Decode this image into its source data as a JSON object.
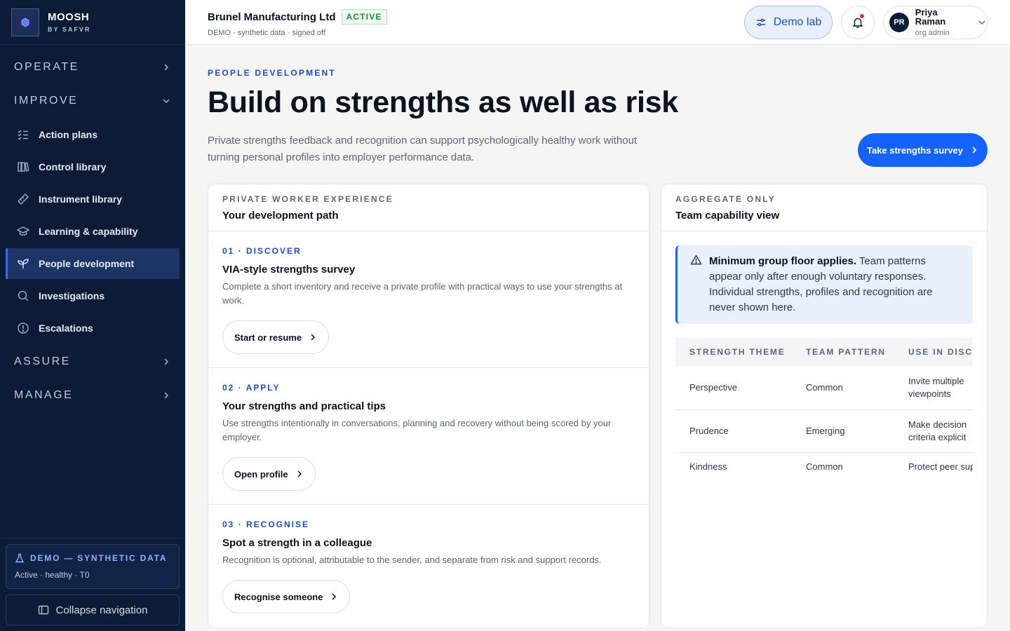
{
  "brand": {
    "name": "MOOSH",
    "sub": "BY SAFVR"
  },
  "sidebar": {
    "sections": [
      {
        "label": "OPERATE",
        "expanded": false
      },
      {
        "label": "IMPROVE",
        "expanded": true
      },
      {
        "label": "ASSURE",
        "expanded": false
      },
      {
        "label": "MANAGE",
        "expanded": false
      }
    ],
    "items": [
      {
        "label": "Action plans",
        "icon": "checklist-icon"
      },
      {
        "label": "Control library",
        "icon": "books-icon"
      },
      {
        "label": "Instrument library",
        "icon": "ruler-icon"
      },
      {
        "label": "Learning & capability",
        "icon": "graduation-cap-icon"
      },
      {
        "label": "People development",
        "icon": "sprout-icon",
        "active": true
      },
      {
        "label": "Investigations",
        "icon": "search-icon"
      },
      {
        "label": "Escalations",
        "icon": "alert-circle-icon"
      }
    ],
    "demo": {
      "title": "DEMO — SYNTHETIC DATA",
      "status": "Active · healthy · T0"
    },
    "collapse_label": "Collapse navigation"
  },
  "header": {
    "org_name": "Brunel Manufacturing Ltd",
    "status_badge": "ACTIVE",
    "org_sub": "DEMO · synthetic data · signed off",
    "demo_lab_label": "Demo lab",
    "user": {
      "initials": "PR",
      "name": "Priya Raman",
      "role": "org admin"
    }
  },
  "page": {
    "eyebrow": "PEOPLE DEVELOPMENT",
    "title": "Build on strengths as well as risk",
    "intro": "Private strengths feedback and recognition can support psychologically healthy work without turning personal profiles into employer performance data.",
    "cta_label": "Take strengths survey"
  },
  "left_card": {
    "eyebrow": "PRIVATE WORKER EXPERIENCE",
    "title": "Your development path",
    "steps": [
      {
        "label": "01 · DISCOVER",
        "title": "VIA-style strengths survey",
        "desc": "Complete a short inventory and receive a private profile with practical ways to use your strengths at work.",
        "button": "Start or resume"
      },
      {
        "label": "02 · APPLY",
        "title": "Your strengths and practical tips",
        "desc": "Use strengths intentionally in conversations, planning and recovery without being scored by your employer.",
        "button": "Open profile"
      },
      {
        "label": "03 · RECOGNISE",
        "title": "Spot a strength in a colleague",
        "desc": "Recognition is optional, attributable to the sender, and separate from risk and support records.",
        "button": "Recognise someone"
      }
    ]
  },
  "right_card": {
    "eyebrow": "AGGREGATE ONLY",
    "title": "Team capability view",
    "notice_bold": "Minimum group floor applies.",
    "notice_text": " Team patterns appear only after enough voluntary responses. Individual strengths, profiles and recognition are never shown here.",
    "table": {
      "headers": [
        "STRENGTH THEME",
        "TEAM PATTERN",
        "USE IN DISCUSSION"
      ],
      "rows": [
        [
          "Perspective",
          "Common",
          "Invite multiple viewpoints"
        ],
        [
          "Prudence",
          "Emerging",
          "Make decision criteria explicit"
        ],
        [
          "Kindness",
          "Common",
          "Protect peer support"
        ]
      ]
    }
  },
  "colors": {
    "sidebar_bg": "#0c1b36",
    "accent": "#1463ff",
    "active_green": "#1e8a4c",
    "notification": "#e03131"
  }
}
